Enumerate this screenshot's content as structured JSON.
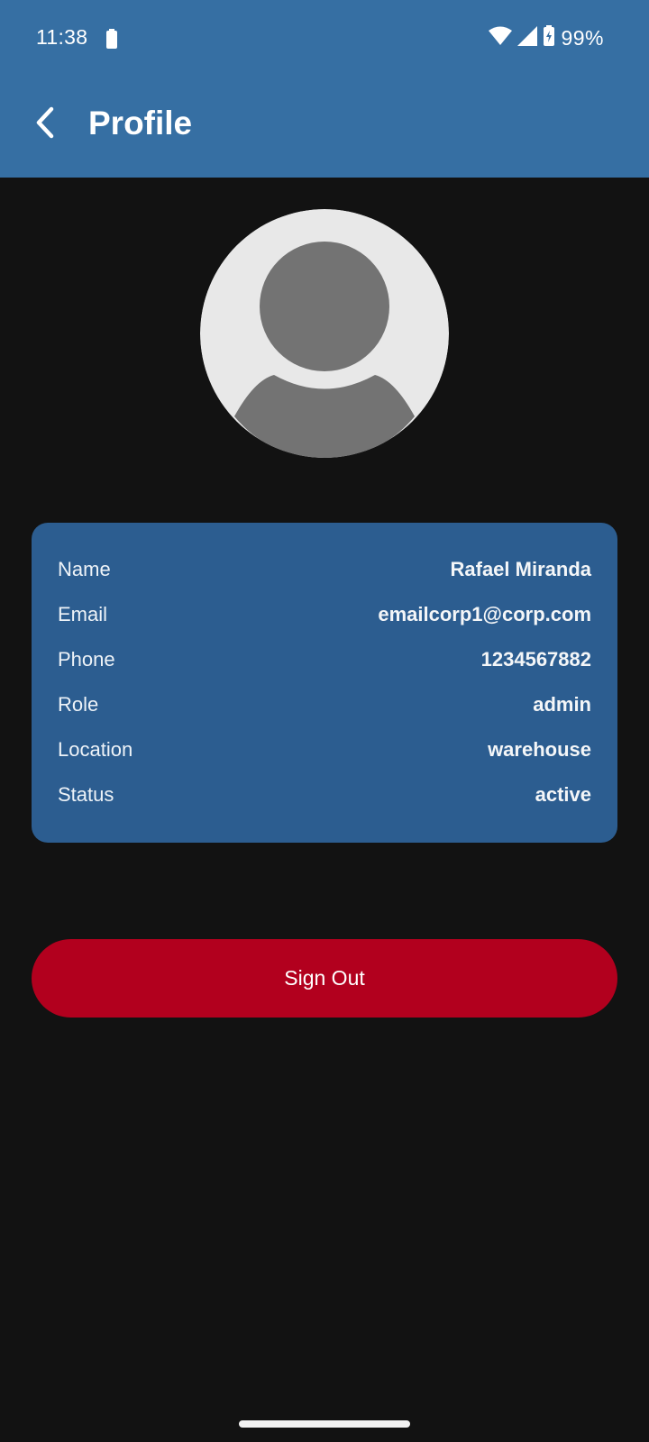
{
  "status_bar": {
    "time": "11:38",
    "battery_percent": "99%",
    "icons": [
      "battery-small-icon",
      "wifi-icon",
      "signal-icon",
      "battery-charging-icon"
    ]
  },
  "toolbar": {
    "back_icon": "chevron-left-icon",
    "title": "Profile"
  },
  "avatar": {
    "icon": "person-placeholder-icon"
  },
  "profile": {
    "rows": [
      {
        "label": "Name",
        "value": "Rafael Miranda"
      },
      {
        "label": "Email",
        "value": "emailcorp1@corp.com"
      },
      {
        "label": "Phone",
        "value": "1234567882"
      },
      {
        "label": "Role",
        "value": "admin"
      },
      {
        "label": "Location",
        "value": "warehouse"
      },
      {
        "label": "Status",
        "value": "active"
      }
    ]
  },
  "actions": {
    "sign_out_label": "Sign Out"
  },
  "colors": {
    "app_bar": "#366fa3",
    "card": "#2c5d90",
    "background": "#121212",
    "sign_out": "#b2001e"
  }
}
